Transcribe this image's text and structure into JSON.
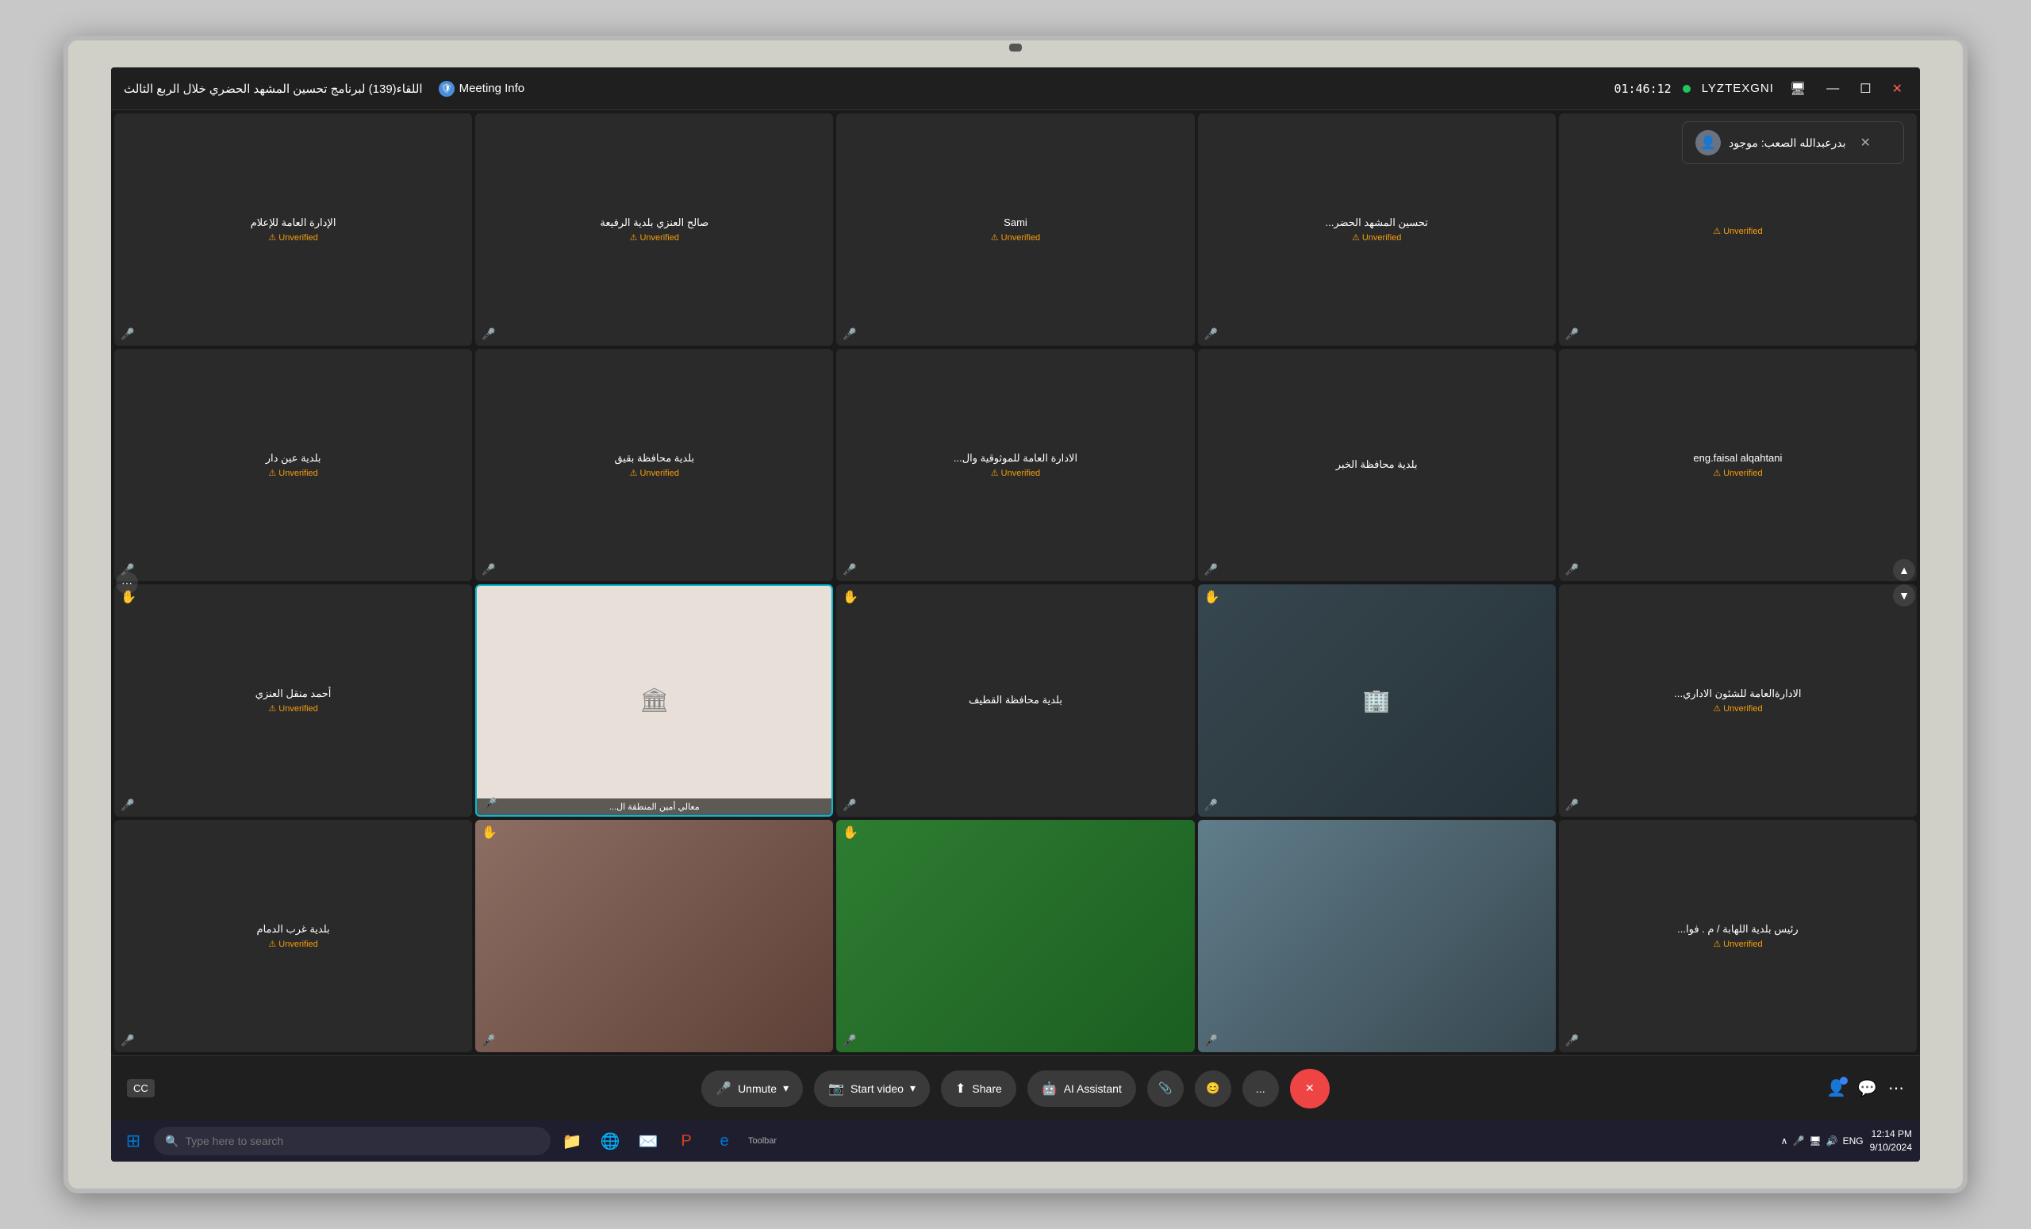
{
  "monitor": {
    "webcam_label": "webcam"
  },
  "title_bar": {
    "meeting_title": "اللقاء(139) لبرنامج تحسين المشهد الحضري خلال الربع الثالث",
    "meeting_info_label": "Meeting Info",
    "timer": "01:46:12",
    "user_name": "LYZTEXGNI",
    "minimize_btn": "—",
    "maximize_btn": "☐",
    "close_btn": "✕"
  },
  "toast": {
    "text": "بدرعبدالله الصعب: موجود",
    "close_btn": "✕"
  },
  "participants": [
    {
      "id": "p1",
      "name": "الإدارة العامة للإعلام",
      "status": "Unverified",
      "has_video": false,
      "raise_hand": false
    },
    {
      "id": "p2",
      "name": "صالح العنزي بلدية الرفيعة",
      "status": "Unverified",
      "has_video": false,
      "raise_hand": false
    },
    {
      "id": "p3",
      "name": "Sami",
      "status": "Unverified",
      "has_video": false,
      "raise_hand": false
    },
    {
      "id": "p4",
      "name": "تحسين المشهد الحضر...",
      "status": "Unverified",
      "has_video": false,
      "raise_hand": false
    },
    {
      "id": "p5",
      "name": "",
      "status": "Unverified",
      "has_video": false,
      "raise_hand": false
    },
    {
      "id": "p6",
      "name": "بلدية عين دار",
      "status": "Unverified",
      "has_video": false,
      "raise_hand": false
    },
    {
      "id": "p7",
      "name": "بلدية محافظة بقيق",
      "status": "Unverified",
      "has_video": false,
      "raise_hand": false
    },
    {
      "id": "p8",
      "name": "الادارة العامة للموثوقية وال...",
      "status": "Unverified",
      "has_video": false,
      "raise_hand": false
    },
    {
      "id": "p9",
      "name": "بلدية محافظة الخبر",
      "status": "",
      "has_video": false,
      "raise_hand": false
    },
    {
      "id": "p10",
      "name": "eng.faisal alqahtani",
      "status": "Unverified",
      "has_video": false,
      "raise_hand": false
    },
    {
      "id": "p11",
      "name": "أحمد منقل العنزي",
      "status": "Unverified",
      "has_video": false,
      "raise_hand": true
    },
    {
      "id": "p12",
      "name": "معالي أمين المنطقة ال...",
      "status": "",
      "has_video": true,
      "raise_hand": false,
      "active": true,
      "video_style": "vid-logo"
    },
    {
      "id": "p13",
      "name": "بلدية محافظة القطيف",
      "status": "",
      "has_video": false,
      "raise_hand": true
    },
    {
      "id": "p14",
      "name": "",
      "status": "",
      "has_video": true,
      "raise_hand": true,
      "video_style": "vid-office"
    },
    {
      "id": "p15",
      "name": "الادارةالعامة للشئون الاداري...",
      "status": "Unverified",
      "has_video": false,
      "raise_hand": false
    },
    {
      "id": "p16",
      "name": "بلدية غرب الدمام",
      "status": "Unverified",
      "has_video": false,
      "raise_hand": false
    },
    {
      "id": "p17",
      "name": "",
      "status": "",
      "has_video": true,
      "raise_hand": true,
      "video_style": "vid-brown"
    },
    {
      "id": "p18",
      "name": "",
      "status": "",
      "has_video": true,
      "raise_hand": true,
      "video_style": "vid-meeting"
    },
    {
      "id": "p19",
      "name": "",
      "status": "",
      "has_video": true,
      "raise_hand": false,
      "video_style": "vid-room"
    },
    {
      "id": "p20",
      "name": "رئيس بلدية اللهابة / م . فوا...",
      "status": "Unverified",
      "has_video": false,
      "raise_hand": false
    },
    {
      "id": "p21",
      "name": "",
      "status": "",
      "has_video": true,
      "raise_hand": true,
      "video_style": "vid-blue"
    },
    {
      "id": "p22",
      "name": "",
      "status": "",
      "has_video": true,
      "raise_hand": true,
      "video_style": "vid-office"
    },
    {
      "id": "p23",
      "name": "",
      "status": "",
      "has_video": true,
      "raise_hand": false,
      "video_style": "vid-meeting"
    },
    {
      "id": "p24",
      "name": "",
      "status": "",
      "has_video": true,
      "raise_hand": false,
      "video_style": "vid-room"
    }
  ],
  "controls": {
    "unmute_label": "Unmute",
    "start_video_label": "Start video",
    "share_label": "Share",
    "ai_assistant_label": "AI Assistant",
    "more_label": "...",
    "end_label": "✕",
    "cc_label": "CC"
  },
  "taskbar": {
    "search_placeholder": "Type here to search",
    "time": "12:14 PM",
    "date": "9/10/2024",
    "language": "ENG"
  },
  "icons": {
    "microphone": "🎤",
    "video_off": "📷",
    "share": "⬆",
    "ai": "🤖",
    "paperclip": "📎",
    "emoji": "😊",
    "participants": "👤",
    "chat": "💬",
    "more_horiz": "⋯",
    "windows_logo": "⊞",
    "search": "🔍"
  }
}
